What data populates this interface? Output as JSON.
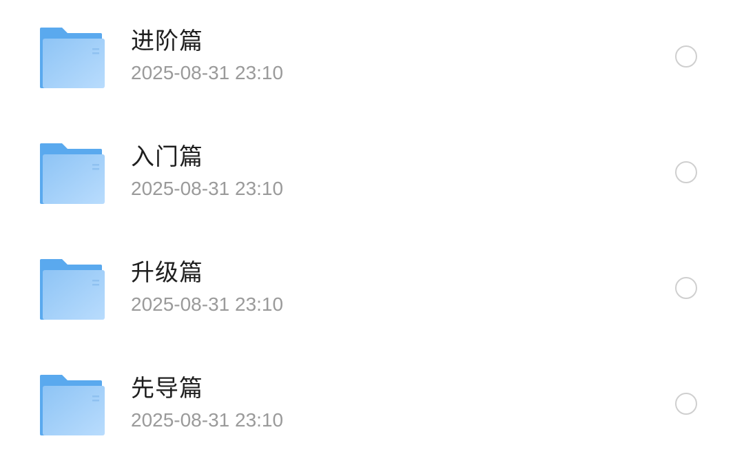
{
  "colors": {
    "folder_back": "#5aa9ee",
    "folder_front_start": "#8ec4f5",
    "folder_front_end": "#b9dcfd",
    "name_text": "#1f1f1f",
    "time_text": "#9a9a9a",
    "radio_border": "#cfcfcf"
  },
  "files": [
    {
      "name": "进阶篇",
      "modified": "2025-08-31 23:10",
      "icon": "folder-icon",
      "selected": false
    },
    {
      "name": "入门篇",
      "modified": "2025-08-31 23:10",
      "icon": "folder-icon",
      "selected": false
    },
    {
      "name": "升级篇",
      "modified": "2025-08-31 23:10",
      "icon": "folder-icon",
      "selected": false
    },
    {
      "name": "先导篇",
      "modified": "2025-08-31 23:10",
      "icon": "folder-icon",
      "selected": false
    }
  ]
}
